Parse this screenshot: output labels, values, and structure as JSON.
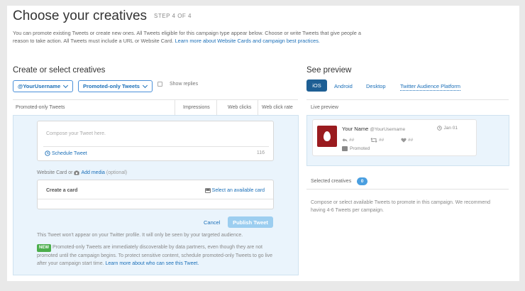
{
  "header": {
    "title": "Choose your creatives",
    "step": "STEP 4 OF 4",
    "intro_text": "You can promote existing Tweets or create new ones. All Tweets eligible for this campaign type appear below. Choose or write Tweets that give people a reason to take action. All Tweets must include a URL or Website Card.",
    "intro_link": "Learn more about Website Cards and campaign best practices."
  },
  "left": {
    "section_title": "Create or select creatives",
    "username_dropdown": "@YourUsername",
    "type_dropdown": "Promoted-only Tweets",
    "show_replies": "Show replies",
    "table": {
      "col_tweets": "Promoted-only Tweets",
      "col_impressions": "Impressions",
      "col_web_clicks": "Web clicks",
      "col_click_rate": "Web click rate"
    },
    "composer": {
      "placeholder": "Compose your Tweet here.",
      "schedule": "Schedule Tweet",
      "char_count": "116",
      "card_label": "Website Card or",
      "add_media": "Add media",
      "optional": "(optional)",
      "create_card": "Create a card",
      "select_card": "Select an available card",
      "cancel": "Cancel",
      "publish": "Publish Tweet"
    },
    "note1": "This Tweet won't appear on your Twitter profile. It will only be seen by your targeted audience.",
    "new_badge": "NEW",
    "note2": "Promoted-only Tweets are immediately discoverable by data partners, even though they are not promoted until the campaign begins. To protect sensitive content, schedule promoted-only Tweets to go live after your campaign start time.",
    "note2_link": "Learn more about who can see this Tweet."
  },
  "right": {
    "section_title": "See preview",
    "tabs": [
      "iOS",
      "Android",
      "Desktop",
      "Twitter Audience Platform"
    ],
    "live_preview": "Live preview",
    "tweet": {
      "name": "Your Name",
      "handle": "@YourUsername",
      "date": "Jan 01",
      "reply_count": "##",
      "retweet_count": "##",
      "like_count": "##",
      "promoted": "Promoted"
    },
    "selected_label": "Selected creatives",
    "selected_count": "0",
    "selected_text": "Compose or select available Tweets to promote in this campaign. We recommend having 4-6 Tweets per campaign."
  },
  "colors": {
    "accent": "#1b6fb8",
    "panel_bg": "#eaf4fc",
    "active_tab": "#1e5f94",
    "avatar": "#9a1b1f",
    "new_badge": "#4cae4c"
  }
}
